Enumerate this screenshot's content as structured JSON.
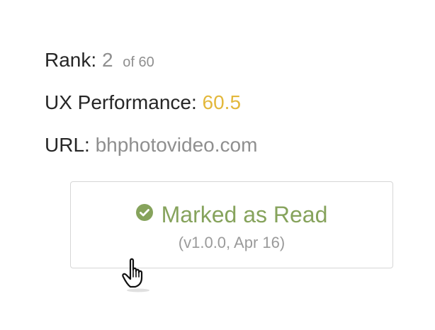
{
  "rank": {
    "label": "Rank:",
    "value": "2",
    "total": "of 60"
  },
  "ux_performance": {
    "label": "UX Performance:",
    "value": "60.5"
  },
  "url": {
    "label": "URL:",
    "value": "bhphotovideo.com"
  },
  "read_status": {
    "icon": "check-circle-icon",
    "label": "Marked as Read",
    "meta": "(v1.0.0, Apr 16)"
  },
  "cursor": {
    "icon": "hand-pointer-icon"
  },
  "colors": {
    "text": "#262626",
    "muted": "#8f8f8f",
    "score": "#e3b83c",
    "read_green": "#86a35c",
    "border": "#d6d6d6"
  }
}
